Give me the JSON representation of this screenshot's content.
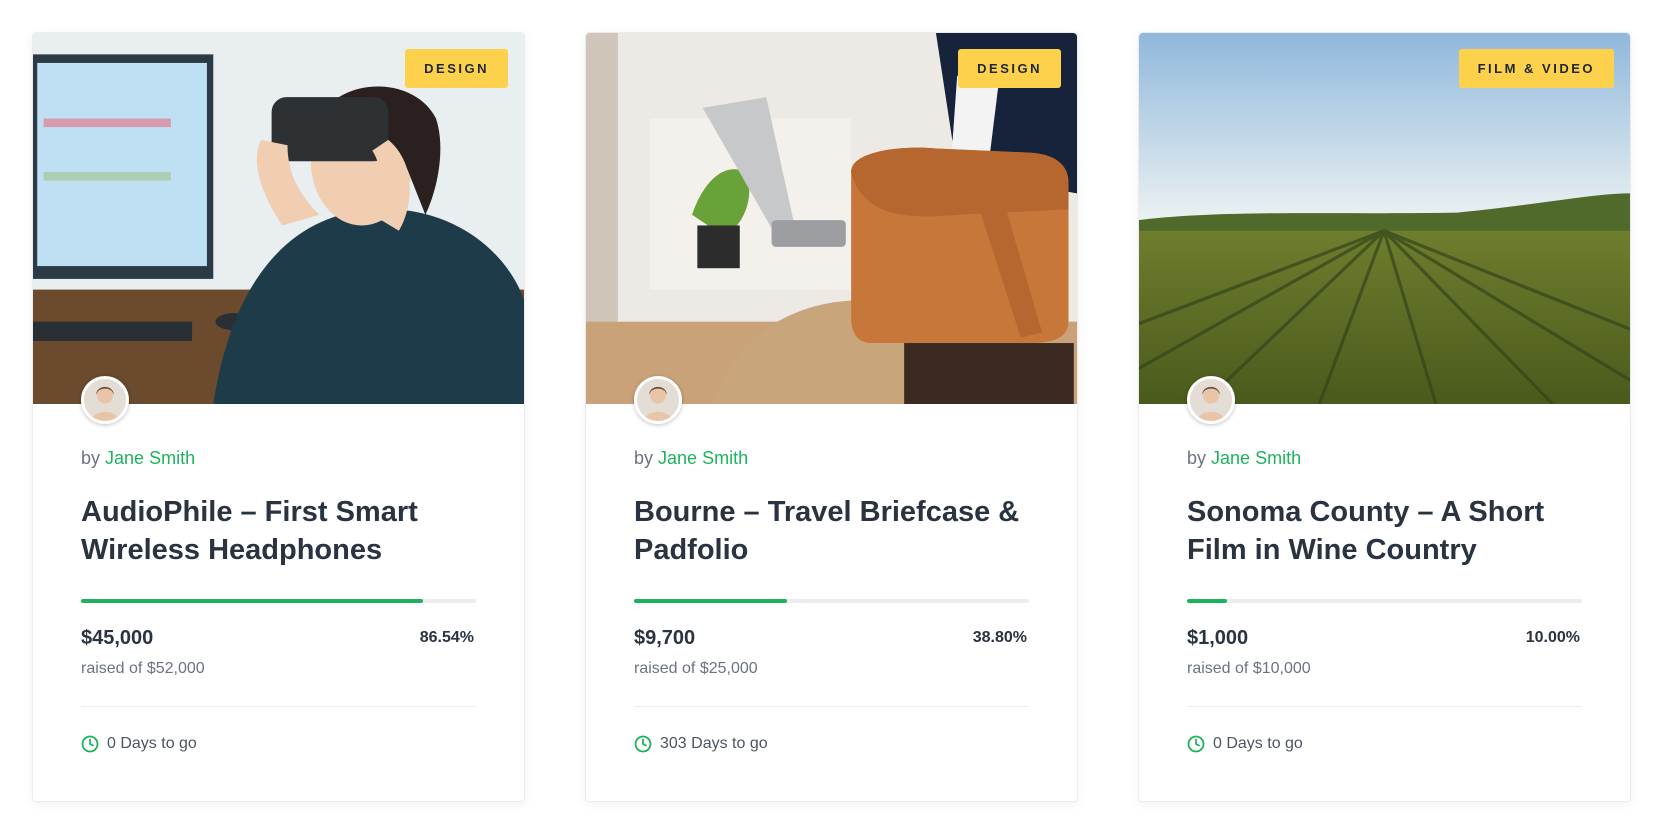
{
  "colors": {
    "accent": "#1db35c",
    "tag": "#fdd14c",
    "text": "#2a3340"
  },
  "campaigns": [
    {
      "category": "DESIGN",
      "by_label": "by",
      "author": "Jane Smith",
      "title": "AudioPhile – First Smart Wireless Headphones",
      "raised": "$45,000",
      "goal": "raised of $52,000",
      "percent_label": "86.54%",
      "progress": 0.8654,
      "days_left": "0 Days to go"
    },
    {
      "category": "DESIGN",
      "by_label": "by",
      "author": "Jane Smith",
      "title": "Bourne – Travel Briefcase & Padfolio",
      "raised": "$9,700",
      "goal": "raised of $25,000",
      "percent_label": "38.80%",
      "progress": 0.388,
      "days_left": "303 Days to go"
    },
    {
      "category": "FILM & VIDEO",
      "by_label": "by",
      "author": "Jane Smith",
      "title": "Sonoma County – A Short Film in Wine Country",
      "raised": "$1,000",
      "goal": "raised of $10,000",
      "percent_label": "10.00%",
      "progress": 0.1,
      "days_left": "0 Days to go"
    }
  ]
}
